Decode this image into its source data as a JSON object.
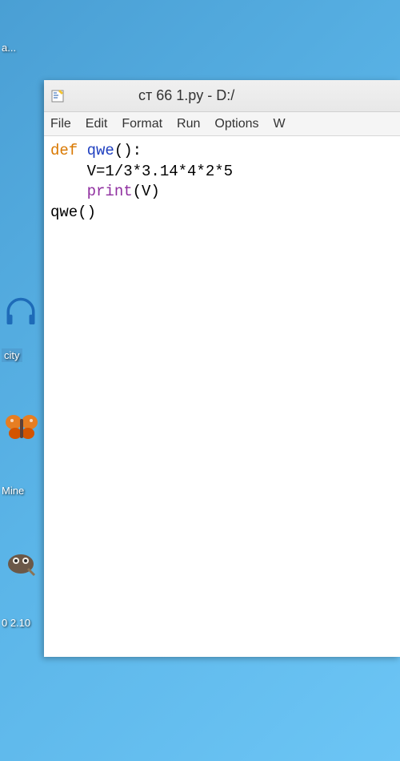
{
  "desktop": {
    "top_label": "a...",
    "city_label": "city",
    "mine_label": "Mine",
    "bottom_label": "0 2.10"
  },
  "window": {
    "title": "ст 66 1.py - D:/"
  },
  "menu": {
    "file": "File",
    "edit": "Edit",
    "format": "Format",
    "run": "Run",
    "options": "Options",
    "window": "W"
  },
  "code": {
    "line1_def": "def",
    "line1_space": " ",
    "line1_func": "qwe",
    "line1_rest": "():",
    "line2": "    V=1/3*3.14*4*2*5",
    "line3_indent": "    ",
    "line3_print": "print",
    "line3_rest": "(V)",
    "line4": "qwe()"
  }
}
